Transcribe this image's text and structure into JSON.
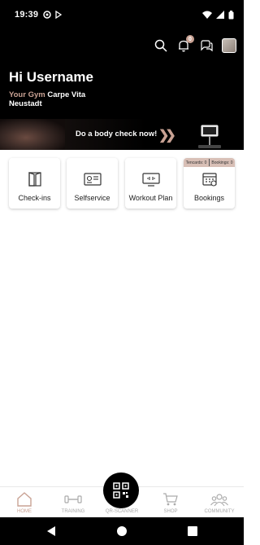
{
  "status_bar": {
    "time": "19:39"
  },
  "greeting": {
    "title": "Hi Username",
    "gym_label": "Your Gym",
    "gym_name": "Carpe Vita",
    "gym_city": "Neustadt"
  },
  "notifications": {
    "count": "0"
  },
  "banner": {
    "cta": "Do a body check now!"
  },
  "tiles": [
    {
      "label": "Check-ins",
      "icon": "door-icon"
    },
    {
      "label": "Selfservice",
      "icon": "id-card-icon"
    },
    {
      "label": "Workout Plan",
      "icon": "monitor-icon"
    },
    {
      "label": "Bookings",
      "icon": "calendar-icon",
      "tencards_label": "Tencards",
      "tencards_count": "0",
      "bookings_label": "Bookings",
      "bookings_count": "0"
    }
  ],
  "bottom_nav": [
    {
      "label": "HOME",
      "active": true
    },
    {
      "label": "TRAINING"
    },
    {
      "label": "QR-SCANNER"
    },
    {
      "label": "SHOP"
    },
    {
      "label": "COMMUNITY"
    }
  ],
  "colors": {
    "accent": "#c9a294",
    "background": "#000000"
  }
}
